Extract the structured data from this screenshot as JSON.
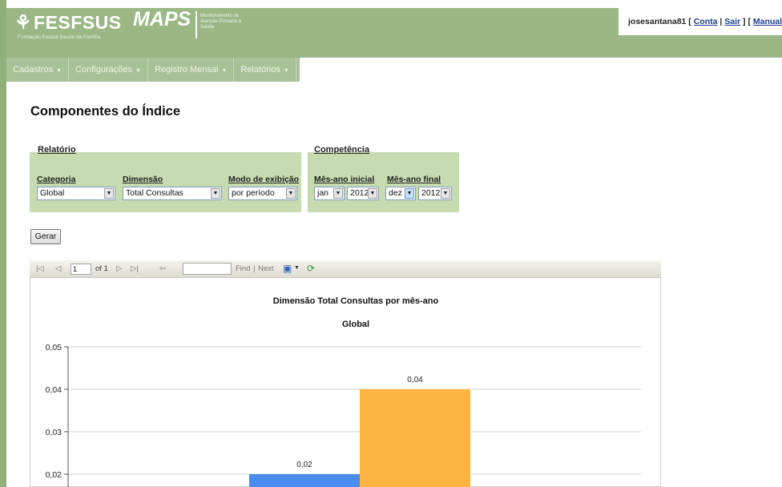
{
  "header": {
    "logo_text": "FESFSUS",
    "logo_subtitle": "Fundação Estatal Saúde da Família",
    "app_name": "MAPS",
    "app_subtitle": "Monitoramento de Atenção Primária à Saúde",
    "user": {
      "username": "josesantana81",
      "conta": "Conta",
      "sair": "Sair",
      "manual": "Manual"
    }
  },
  "nav": [
    {
      "label": "Cadastros"
    },
    {
      "label": "Configurações"
    },
    {
      "label": "Registro Mensal"
    },
    {
      "label": "Relatórios"
    }
  ],
  "page_title": "Componentes do Índice",
  "relatorio": {
    "legend": "Relatório",
    "categoria": {
      "label": "Categoria",
      "value": "Global"
    },
    "dimensao": {
      "label": "Dimensão",
      "value": "Total Consultas"
    },
    "modo": {
      "label": "Modo de exibição",
      "value": "por período"
    }
  },
  "competencia": {
    "legend": "Competência",
    "inicial": {
      "label": "Mês-ano inicial",
      "month": "jan",
      "year": "2012"
    },
    "final": {
      "label": "Mês-ano final",
      "month": "dez",
      "year": "2012"
    }
  },
  "gerar_label": "Gerar",
  "toolbar": {
    "page": "1",
    "of_label": "of 1",
    "find_label": "Find",
    "separator": "|",
    "next_label": "Next"
  },
  "colors": {
    "accent": "#9ab785",
    "bar_blue": "#4a8df0",
    "bar_orange": "#fbb442"
  },
  "chart_data": {
    "type": "bar",
    "title": "Dimensão Total Consultas por mês-ano",
    "subtitle": "Global",
    "ylim": [
      0.02,
      0.05
    ],
    "y_ticks": [
      "0,05",
      "0,04",
      "0,03",
      "0,02"
    ],
    "grid": true,
    "series": [
      {
        "value": 0.02,
        "label": "0,02",
        "color": "#4a8df0"
      },
      {
        "value": 0.04,
        "label": "0,04",
        "color": "#fbb442"
      }
    ]
  }
}
